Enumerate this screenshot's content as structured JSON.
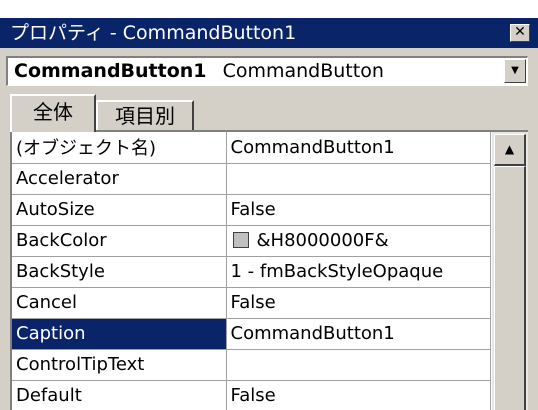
{
  "window": {
    "title": "プロパティ - CommandButton1",
    "close_glyph": "✕"
  },
  "object_selector": {
    "object_name": "CommandButton1",
    "object_type": "CommandButton",
    "arrow_glyph": "▼"
  },
  "tabs": [
    {
      "label": "全体",
      "active": true
    },
    {
      "label": "項目別",
      "active": false
    }
  ],
  "properties": [
    {
      "name": "(オブジェクト名)",
      "value": "CommandButton1"
    },
    {
      "name": "Accelerator",
      "value": ""
    },
    {
      "name": "AutoSize",
      "value": "False"
    },
    {
      "name": "BackColor",
      "value": "&H8000000F&",
      "swatch_color": "#c0c0c0"
    },
    {
      "name": "BackStyle",
      "value": "1 - fmBackStyleOpaque"
    },
    {
      "name": "Cancel",
      "value": "False"
    },
    {
      "name": "Caption",
      "value": "CommandButton1",
      "selected": true
    },
    {
      "name": "ControlTipText",
      "value": ""
    },
    {
      "name": "Default",
      "value": "False"
    }
  ],
  "scrollbar": {
    "up_glyph": "▲"
  },
  "colors": {
    "title_bar": "#0a246a",
    "face": "#d4d0c8",
    "selection": "#0a246a"
  }
}
